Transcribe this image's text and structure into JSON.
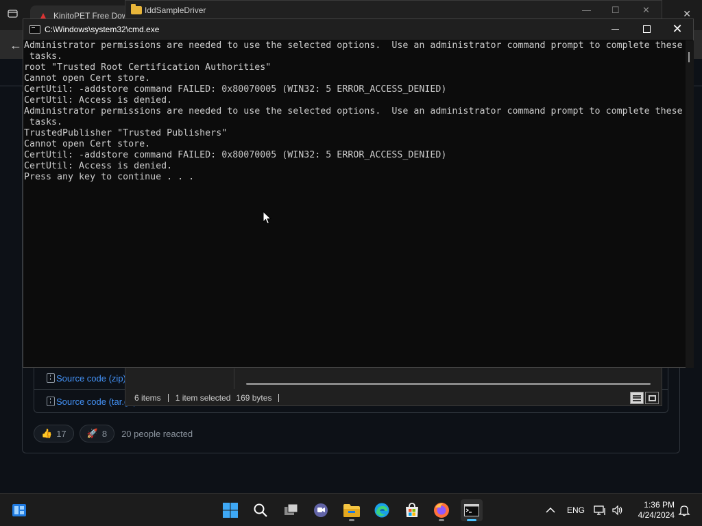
{
  "browser": {
    "tab_title": "KinitoPET Free Down",
    "assets": [
      {
        "label": "Source code (zip)"
      },
      {
        "label": "Source code (tar.gz)"
      }
    ],
    "reactions": [
      {
        "emoji": "👍",
        "count": "17"
      },
      {
        "emoji": "🚀",
        "count": "8"
      }
    ],
    "reactions_text": "20 people reacted"
  },
  "explorer": {
    "title": "IddSampleDriver",
    "status": {
      "items": "6 items",
      "selected": "1 item selected",
      "size": "169 bytes"
    }
  },
  "cmd": {
    "title": "C:\\Windows\\system32\\cmd.exe",
    "lines": [
      "Administrator permissions are needed to use the selected options.  Use an administrator command prompt to complete these",
      " tasks.",
      "root \"Trusted Root Certification Authorities\"",
      "Cannot open Cert store.",
      "CertUtil: -addstore command FAILED: 0x80070005 (WIN32: 5 ERROR_ACCESS_DENIED)",
      "CertUtil: Access is denied.",
      "Administrator permissions are needed to use the selected options.  Use an administrator command prompt to complete these",
      " tasks.",
      "TrustedPublisher \"Trusted Publishers\"",
      "Cannot open Cert store.",
      "CertUtil: -addstore command FAILED: 0x80070005 (WIN32: 5 ERROR_ACCESS_DENIED)",
      "CertUtil: Access is denied.",
      "Press any key to continue . . ."
    ]
  },
  "taskbar": {
    "apps": [
      {
        "name": "start-button",
        "icon": "windows-logo-icon"
      },
      {
        "name": "search-button",
        "icon": "search-icon"
      },
      {
        "name": "task-view-button",
        "icon": "task-view-icon"
      },
      {
        "name": "teams-chat-button",
        "icon": "chat-icon"
      },
      {
        "name": "file-explorer-button",
        "icon": "folder-icon"
      },
      {
        "name": "edge-button",
        "icon": "edge-icon"
      },
      {
        "name": "store-button",
        "icon": "store-icon"
      },
      {
        "name": "firefox-button",
        "icon": "firefox-icon"
      },
      {
        "name": "terminal-button",
        "icon": "terminal-icon"
      }
    ],
    "language": "ENG",
    "time": "1:36 PM",
    "date": "4/24/2024"
  }
}
